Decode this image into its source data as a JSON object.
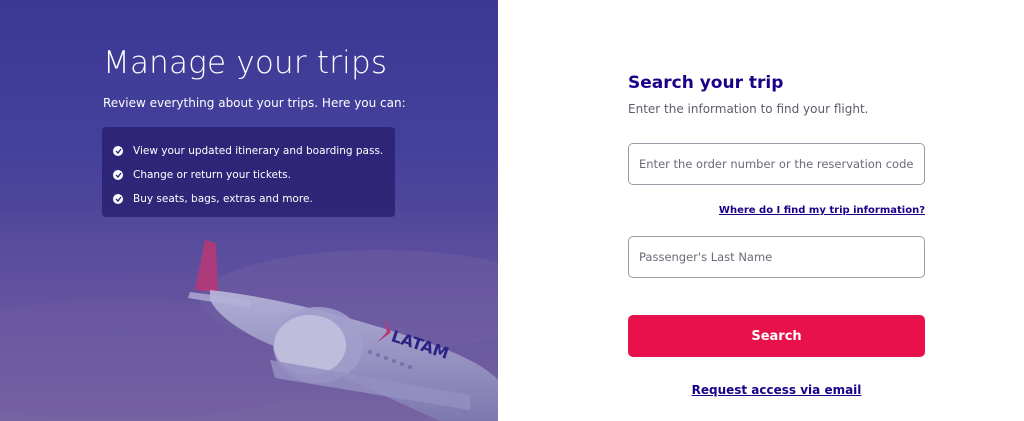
{
  "hero": {
    "title": "Manage your trips",
    "subtitle": "Review everything about your trips. Here you can:",
    "features": [
      {
        "label": "View your updated itinerary and boarding pass.",
        "icon": "check-circle-icon"
      },
      {
        "label": "Change or return your tickets.",
        "icon": "check-circle-icon"
      },
      {
        "label": "Buy seats, bags, extras and more.",
        "icon": "check-circle-icon"
      }
    ],
    "brand_text": "LATAM"
  },
  "form": {
    "title": "Search your trip",
    "subtitle": "Enter the information to find your flight.",
    "order_field": {
      "placeholder": "Enter the order number or the reservation code",
      "value": ""
    },
    "help_link": "Where do I find my trip information?",
    "lastname_field": {
      "placeholder": "Passenger's Last Name",
      "value": ""
    },
    "search_button": "Search",
    "email_link": "Request access via email"
  },
  "colors": {
    "primary_navy": "#1b0088",
    "accent_red": "#e8114b",
    "hero_purple": "#48449e"
  }
}
